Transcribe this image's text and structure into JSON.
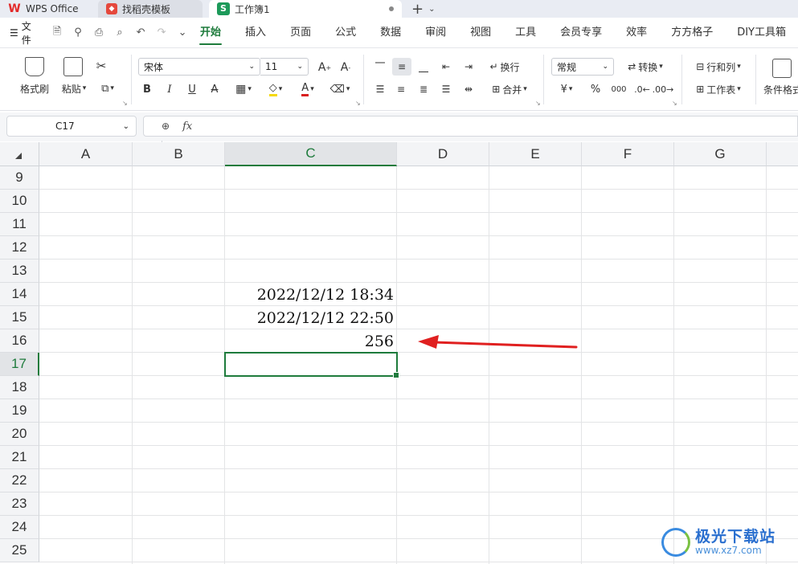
{
  "tabs": [
    {
      "label": "WPS Office"
    },
    {
      "label": "找稻壳模板"
    },
    {
      "label": "工作簿1"
    }
  ],
  "menu": {
    "file_label": "文件",
    "tabs": [
      "开始",
      "插入",
      "页面",
      "公式",
      "数据",
      "审阅",
      "视图",
      "工具",
      "会员专享",
      "效率",
      "方方格子",
      "DIY工具箱"
    ]
  },
  "ribbon": {
    "format_painter": "格式刷",
    "paste": "粘贴",
    "font_name": "宋体",
    "font_size": "11",
    "wrap": "换行",
    "merge": "合并",
    "number_format": "常规",
    "convert": "转换",
    "rows_cols": "行和列",
    "worksheet": "工作表",
    "conditional": "条件格式",
    "currency_symbol": "¥",
    "percent_symbol": "%",
    "thousands_symbol": "000",
    "bold": "B",
    "italic": "I",
    "underline": "U",
    "strike": "A",
    "font_color_glyph": "A",
    "grow_font": "A",
    "shrink_font": "A"
  },
  "formula_bar": {
    "cell_ref": "C17",
    "fx_label": "fx",
    "content": ""
  },
  "columns": [
    "A",
    "B",
    "C",
    "D",
    "E",
    "F",
    "G"
  ],
  "rows": [
    "9",
    "10",
    "11",
    "12",
    "13",
    "14",
    "15",
    "16",
    "17",
    "18",
    "19",
    "20",
    "21",
    "22",
    "23",
    "24",
    "25"
  ],
  "cells": {
    "C14": "2022/12/12  18:34",
    "C15": "2022/12/12  22:50",
    "C16": "256"
  },
  "selected_cell": "C17",
  "watermark": {
    "name": "极光下载站",
    "url": "www.xz7.com"
  },
  "colors": {
    "accent": "#1e7b3c",
    "arrow": "#e02020"
  }
}
